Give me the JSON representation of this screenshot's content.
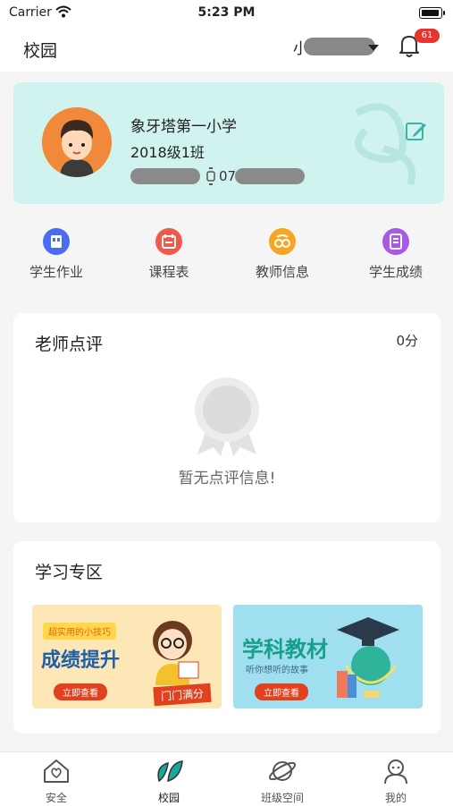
{
  "status_bar": {
    "carrier": "Carrier",
    "time": "5:23 PM"
  },
  "nav": {
    "title": "校园",
    "user_name": "小",
    "badge_count": "61"
  },
  "school_card": {
    "school_name": "象牙塔第一小学",
    "class_name": "2018级1班",
    "phone_prefix": "07"
  },
  "quick_actions": [
    {
      "label": "学生作业",
      "icon": "homework-icon",
      "color": "#4a6cf0"
    },
    {
      "label": "课程表",
      "icon": "calendar-icon",
      "color": "#f05a4a"
    },
    {
      "label": "教师信息",
      "icon": "glasses-icon",
      "color": "#f6a623"
    },
    {
      "label": "学生成绩",
      "icon": "document-icon",
      "color": "#a85ae6"
    }
  ],
  "review": {
    "title": "老师点评",
    "score": "0分",
    "empty_text": "暂无点评信息!"
  },
  "study": {
    "title": "学习专区",
    "banner_a": {
      "tag": "超实用的小技巧",
      "headline": "成绩提升",
      "cta": "立即查看",
      "ribbon": "门门满分"
    },
    "banner_b": {
      "headline": "学科教材",
      "subtitle": "听你想听的故事",
      "cta": "立即查看"
    }
  },
  "tabbar": [
    {
      "label": "安全",
      "icon": "home-heart-icon"
    },
    {
      "label": "校园",
      "icon": "leaf-icon",
      "active": true
    },
    {
      "label": "班级空间",
      "icon": "planet-icon"
    },
    {
      "label": "我的",
      "icon": "user-icon"
    }
  ],
  "colors": {
    "accent": "#d1f3ef",
    "badge": "#e8332f",
    "active_tab": "#1aa89c"
  }
}
